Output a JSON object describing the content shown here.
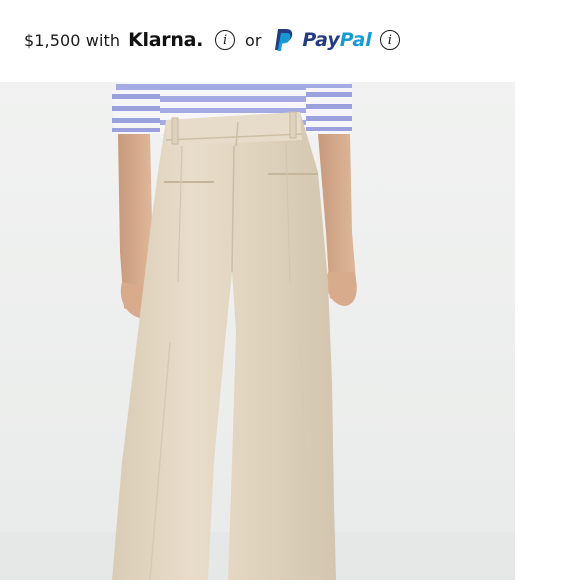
{
  "payment_bar": {
    "price_text": "$1,500 with",
    "klarna_logo": "Klarna.",
    "separator": "or",
    "paypal_logo_pay": "Pay",
    "paypal_logo_pal": "Pal",
    "info_icon_glyph": "i"
  },
  "colors": {
    "paypal_dark": "#253b80",
    "paypal_light": "#179bd7",
    "image_background": "#eef0ef",
    "pants": "#e4d9c6",
    "shirt_stripe": "#9fa6df"
  },
  "icons": [
    "info-icon",
    "paypal-p-mark"
  ]
}
